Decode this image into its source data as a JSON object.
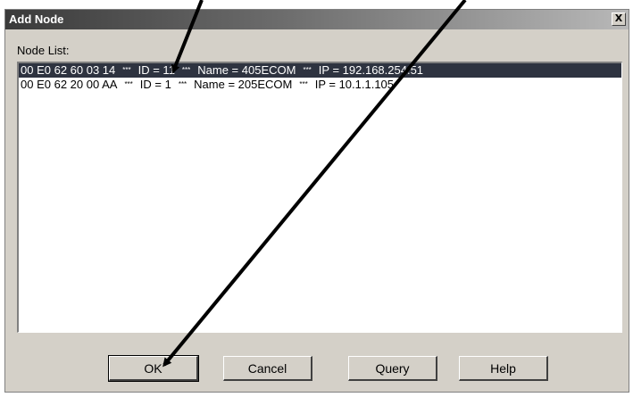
{
  "window": {
    "title": "Add Node",
    "close_glyph": "X"
  },
  "node_list": {
    "label": "Node List:",
    "items": [
      {
        "mac": "00 E0 62 60 03 14",
        "id": "ID = 11",
        "name": "Name = 405ECOM",
        "ip": "IP = 192.168.254.51",
        "selected": true
      },
      {
        "mac": "00 E0 62 20 00 AA",
        "id": "ID = 1",
        "name": "Name = 205ECOM",
        "ip": "IP = 10.1.1.105",
        "selected": false
      }
    ],
    "separator": "***"
  },
  "buttons": {
    "ok": "OK",
    "cancel": "Cancel",
    "query": "Query",
    "help": "Help"
  },
  "colors": {
    "selection": "#2e3340",
    "dialog_face": "#d4d0c8",
    "annotation_arrow": "#000000"
  }
}
